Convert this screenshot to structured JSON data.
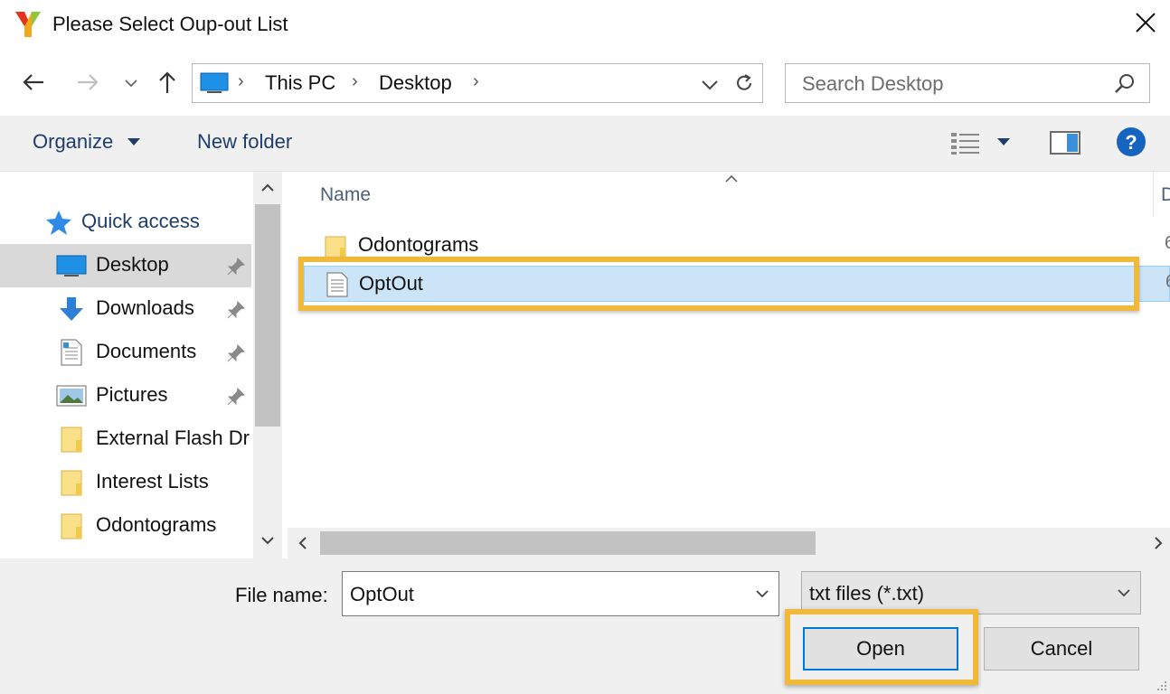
{
  "window": {
    "title": "Please Select Oup-out List",
    "accent": "#0078d7",
    "highlight_color": "#f0b93a"
  },
  "address_bar": {
    "breadcrumbs": [
      "This PC",
      "Desktop"
    ],
    "search_placeholder": "Search Desktop"
  },
  "toolbar": {
    "organize_label": "Organize",
    "new_folder_label": "New folder"
  },
  "nav_pane": {
    "quick_access_label": "Quick access",
    "items": [
      {
        "label": "Desktop",
        "icon": "desktop-icon",
        "pinned": true,
        "selected": true
      },
      {
        "label": "Downloads",
        "icon": "download-arrow-icon",
        "pinned": true
      },
      {
        "label": "Documents",
        "icon": "document-icon",
        "pinned": true
      },
      {
        "label": "Pictures",
        "icon": "picture-icon",
        "pinned": true
      },
      {
        "label": "External Flash Dr",
        "icon": "folder-icon"
      },
      {
        "label": "Interest Lists",
        "icon": "folder-icon"
      },
      {
        "label": "Odontograms",
        "icon": "folder-icon"
      }
    ]
  },
  "file_list": {
    "column_name": "Name",
    "column_date_peek": "D",
    "rows": [
      {
        "name": "Odontograms",
        "icon": "folder-icon",
        "date_peek": "6"
      },
      {
        "name": "OptOut",
        "icon": "text-file-icon",
        "date_peek": "6",
        "selected": true
      }
    ]
  },
  "footer": {
    "file_name_label": "File name:",
    "file_name_value": "OptOut",
    "file_type_value": "txt files (*.txt)",
    "open_label": "Open",
    "cancel_label": "Cancel"
  }
}
